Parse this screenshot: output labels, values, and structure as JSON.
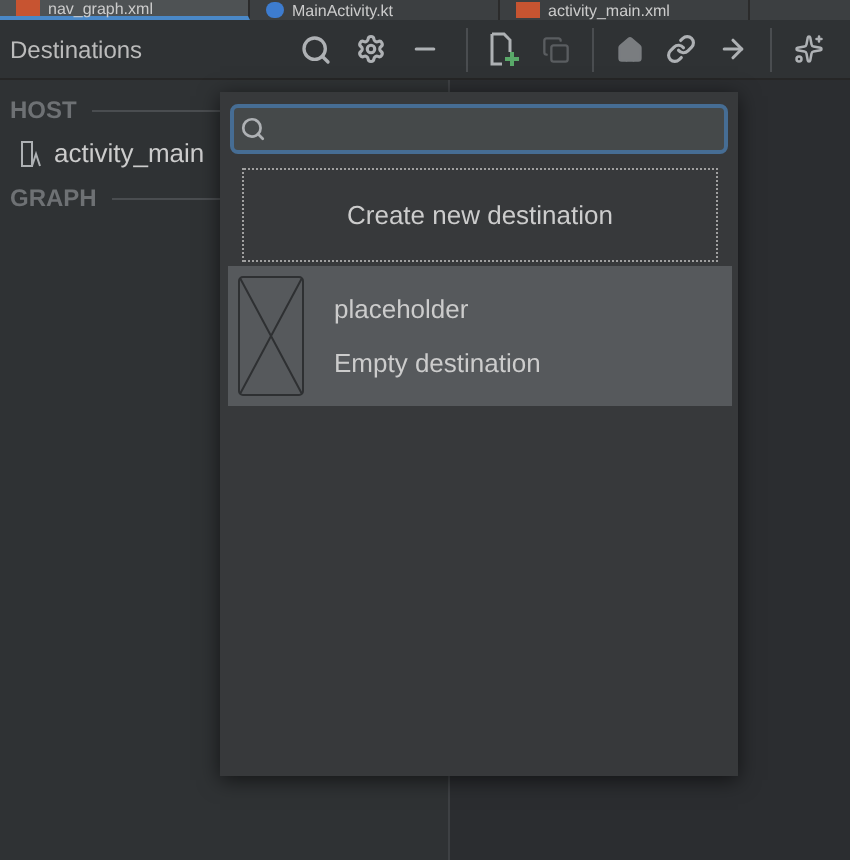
{
  "editor_tabs": [
    {
      "label": "nav_graph.xml",
      "selected": true,
      "kind": "xml"
    },
    {
      "label": "MainActivity.kt",
      "selected": false,
      "kind": "kotlin"
    },
    {
      "label": "activity_main.xml",
      "selected": false,
      "kind": "xml"
    }
  ],
  "panel": {
    "title": "Destinations",
    "sections": [
      {
        "label": "HOST",
        "items": [
          {
            "label": "activity_main"
          }
        ]
      },
      {
        "label": "GRAPH"
      }
    ]
  },
  "popup": {
    "create_button": "Create new destination",
    "destinations": [
      {
        "name": "placeholder",
        "description": "Empty destination",
        "selected": true
      }
    ]
  }
}
